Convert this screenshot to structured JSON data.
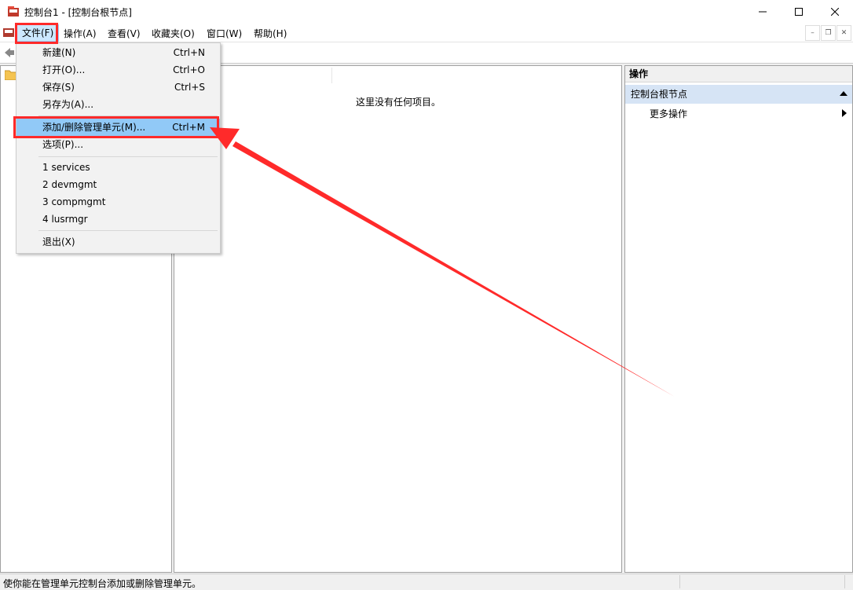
{
  "window": {
    "title": "控制台1 - [控制台根节点]",
    "controls": [
      "minimize-icon",
      "maximize-icon",
      "close-icon"
    ]
  },
  "menubar": {
    "items": [
      "文件(F)",
      "操作(A)",
      "查看(V)",
      "收藏夹(O)",
      "窗口(W)",
      "帮助(H)"
    ],
    "mdi_controls": [
      "minimize-icon",
      "restore-icon",
      "close-icon"
    ]
  },
  "file_menu": {
    "items": [
      {
        "label": "新建(N)",
        "shortcut": "Ctrl+N"
      },
      {
        "label": "打开(O)...",
        "shortcut": "Ctrl+O"
      },
      {
        "label": "保存(S)",
        "shortcut": "Ctrl+S"
      },
      {
        "label": "另存为(A)...",
        "shortcut": ""
      },
      {
        "label": "添加/删除管理单元(M)...",
        "shortcut": "Ctrl+M",
        "highlighted": true
      },
      {
        "label": "选项(P)...",
        "shortcut": ""
      },
      {
        "label": "1 services",
        "shortcut": ""
      },
      {
        "label": "2 devmgmt",
        "shortcut": ""
      },
      {
        "label": "3 compmgmt",
        "shortcut": ""
      },
      {
        "label": "4 lusrmgr",
        "shortcut": ""
      },
      {
        "label": "退出(X)",
        "shortcut": ""
      }
    ]
  },
  "center": {
    "empty_message": "这里没有任何项目。"
  },
  "actions": {
    "header": "操作",
    "section": "控制台根节点",
    "items": [
      "更多操作"
    ]
  },
  "statusbar": {
    "text": "使你能在管理单元控制台添加或删除管理单元。"
  },
  "colors": {
    "highlight": "#91c9f7",
    "annotation": "#ff2a2a",
    "section_bg": "#d6e4f5"
  }
}
